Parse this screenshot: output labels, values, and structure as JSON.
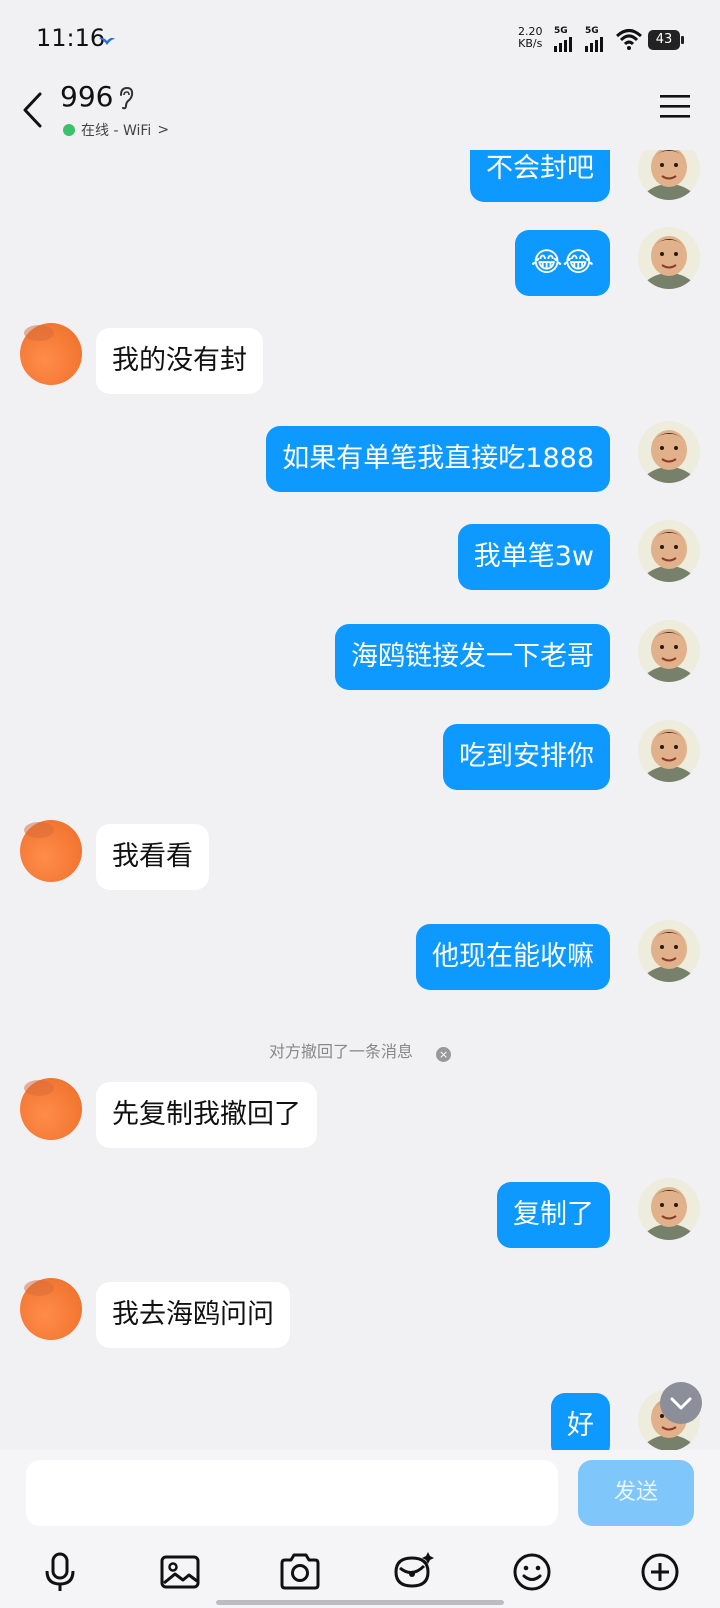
{
  "status_bar": {
    "time": "11:16",
    "net_speed_value": "2.20",
    "net_speed_unit": "KB/s",
    "sim1_label": "5G",
    "sim2_label": "5G",
    "battery": "43"
  },
  "header": {
    "title": "996",
    "presence": "在线 - WiFi",
    "presence_chevron": ">"
  },
  "messages": [
    {
      "side": "out",
      "text": "不会封吧"
    },
    {
      "side": "out",
      "text": "😂😂"
    },
    {
      "side": "in",
      "text": "我的没有封"
    },
    {
      "side": "out",
      "text": "如果有单笔我直接吃1888"
    },
    {
      "side": "out",
      "text": "我单笔3w"
    },
    {
      "side": "out",
      "text": "海鸥链接发一下老哥"
    },
    {
      "side": "out",
      "text": "吃到安排你"
    },
    {
      "side": "in",
      "text": "我看看"
    },
    {
      "side": "out",
      "text": "他现在能收嘛"
    },
    {
      "side": "system",
      "text": "对方撤回了一条消息"
    },
    {
      "side": "in",
      "text": "先复制我撤回了"
    },
    {
      "side": "out",
      "text": "复制了"
    },
    {
      "side": "in",
      "text": "我去海鸥问问"
    },
    {
      "side": "out",
      "text": "好"
    }
  ],
  "composer": {
    "input_value": "",
    "send_label": "发送"
  },
  "toolbar_icons": [
    "microphone-icon",
    "image-icon",
    "camera-icon",
    "red-packet-icon",
    "emoji-icon",
    "plus-icon"
  ],
  "colors": {
    "outgoing_bubble": "#0d99ff",
    "incoming_bubble": "#ffffff",
    "background": "#f1f1f4",
    "send_button_disabled": "#7fc6fb",
    "online_dot": "#3ac16a"
  }
}
